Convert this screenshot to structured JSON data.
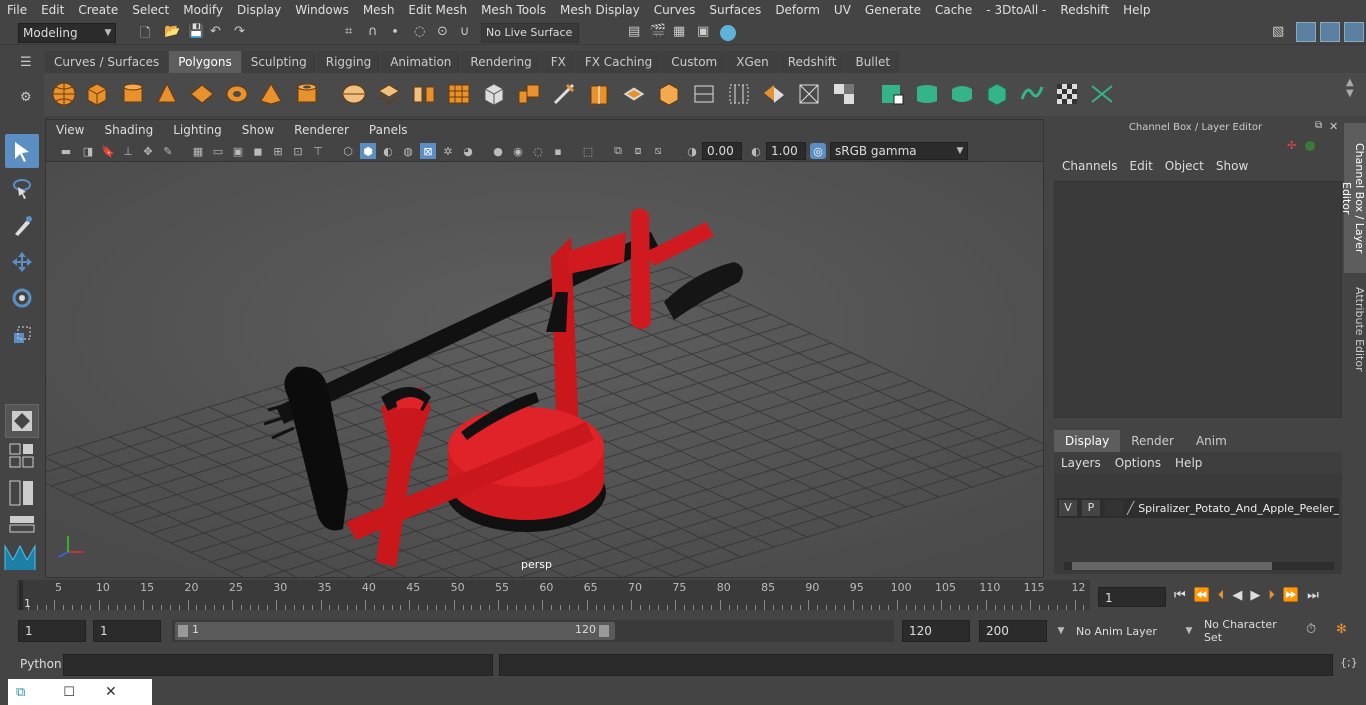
{
  "menubar": [
    "File",
    "Edit",
    "Create",
    "Select",
    "Modify",
    "Display",
    "Windows",
    "Mesh",
    "Edit Mesh",
    "Mesh Tools",
    "Mesh Display",
    "Curves",
    "Surfaces",
    "Deform",
    "UV",
    "Generate",
    "Cache",
    "- 3DtoAll -",
    "Redshift",
    "Help"
  ],
  "status": {
    "mode": "Modeling",
    "live_surface": "No Live Surface"
  },
  "shelf_tabs": [
    "Curves / Surfaces",
    "Polygons",
    "Sculpting",
    "Rigging",
    "Animation",
    "Rendering",
    "FX",
    "FX Caching",
    "Custom",
    "XGen",
    "Redshift",
    "Bullet"
  ],
  "shelf_active": "Polygons",
  "viewport": {
    "menu": [
      "View",
      "Shading",
      "Lighting",
      "Show",
      "Renderer",
      "Panels"
    ],
    "exposure": "0.00",
    "gamma": "1.00",
    "color_space": "sRGB gamma",
    "camera_label": "persp"
  },
  "channel_box": {
    "title": "Channel Box / Layer Editor",
    "menu": [
      "Channels",
      "Edit",
      "Object",
      "Show"
    ],
    "layer_tabs": [
      "Display",
      "Render",
      "Anim"
    ],
    "layer_menu": [
      "Layers",
      "Options",
      "Help"
    ],
    "layer": {
      "v": "V",
      "p": "P",
      "name": "Spiralizer_Potato_And_Apple_Peeler_"
    }
  },
  "side_tabs": [
    "Channel Box / Layer Editor",
    "Attribute Editor"
  ],
  "timeline": {
    "ticks": [
      "5",
      "10",
      "15",
      "20",
      "25",
      "30",
      "35",
      "40",
      "45",
      "50",
      "55",
      "60",
      "65",
      "70",
      "75",
      "80",
      "85",
      "90",
      "95",
      "100",
      "105",
      "110",
      "115",
      "12"
    ],
    "start_marker": "1",
    "current_frame": "1"
  },
  "range": {
    "start": "1",
    "anim_start": "1",
    "slider_start": "1",
    "slider_end": "120",
    "end": "120",
    "anim_end": "200",
    "anim_layer": "No Anim Layer",
    "character_set": "No Character Set"
  },
  "command": {
    "label": "Python"
  }
}
